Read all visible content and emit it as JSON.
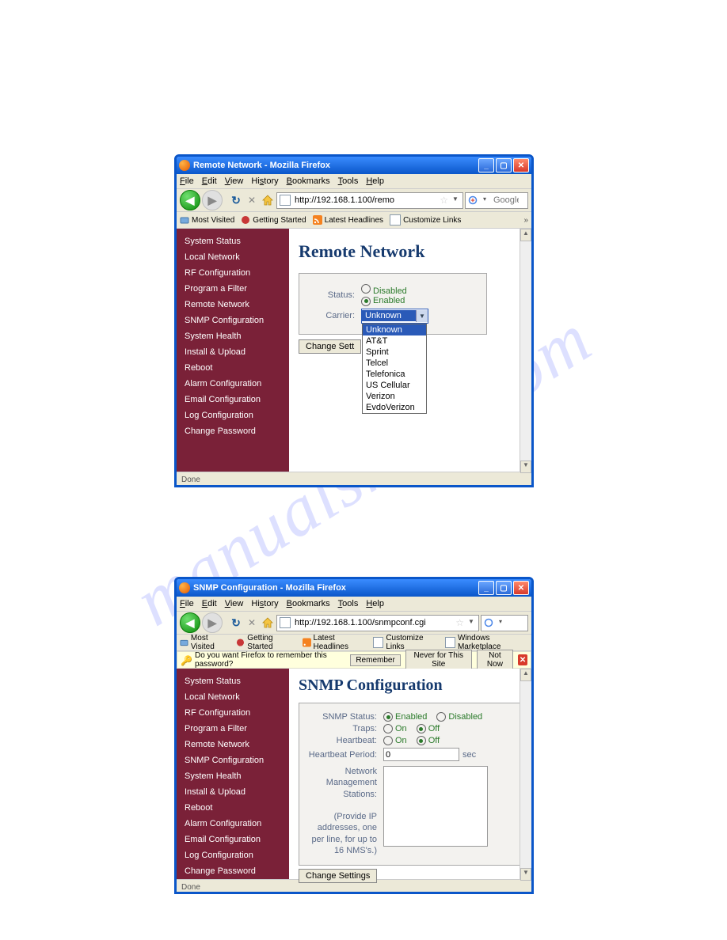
{
  "watermark": "manualshive.com",
  "sidebar_items": [
    "System Status",
    "Local Network",
    "RF Configuration",
    "Program a Filter",
    "Remote Network",
    "SNMP Configuration",
    "System Health",
    "Install & Upload",
    "Reboot",
    "Alarm Configuration",
    "Email Configuration",
    "Log Configuration",
    "Change Password"
  ],
  "menu": [
    "File",
    "Edit",
    "View",
    "History",
    "Bookmarks",
    "Tools",
    "Help"
  ],
  "bookmarks": [
    {
      "label": "Most Visited",
      "icon": "mv"
    },
    {
      "label": "Getting Started",
      "icon": "gs"
    },
    {
      "label": "Latest Headlines",
      "icon": "rss"
    },
    {
      "label": "Customize Links",
      "icon": "pg"
    }
  ],
  "bookmarks2_extra": {
    "label": "Windows Marketplace",
    "icon": "pg"
  },
  "win1": {
    "title": "Remote Network - Mozilla Firefox",
    "url": "http://192.168.1.100/remo",
    "search_ph": "Google",
    "heading": "Remote Network",
    "status_label": "Status:",
    "carrier_label": "Carrier:",
    "disabled": "Disabled",
    "enabled": "Enabled",
    "selected_carrier": "Unknown",
    "carriers": [
      "Unknown",
      "AT&T",
      "Sprint",
      "Telcel",
      "Telefonica",
      "US Cellular",
      "Verizon",
      "EvdoVerizon"
    ],
    "change_btn": "Change Sett",
    "status_bar": "Done"
  },
  "win2": {
    "title": "SNMP Configuration - Mozilla Firefox",
    "url": "http://192.168.1.100/snmpconf.cgi",
    "search_ph": "",
    "pw_prompt": "Do you want Firefox to remember this password?",
    "pw_remember": "Remember",
    "pw_never": "Never for This Site",
    "pw_notnow": "Not Now",
    "heading": "SNMP Configuration",
    "snmp_status": "SNMP Status:",
    "traps": "Traps:",
    "heartbeat": "Heartbeat:",
    "hb_period": "Heartbeat Period:",
    "enabled": "Enabled",
    "disabled": "Disabled",
    "on": "On",
    "off": "Off",
    "hb_value": "0",
    "sec": "sec",
    "nms_label": "Network Management Stations:",
    "nms_hint": "(Provide IP addresses, one per line, for up to 16 NMS's.)",
    "change_btn": "Change Settings",
    "status_bar": "Done"
  }
}
